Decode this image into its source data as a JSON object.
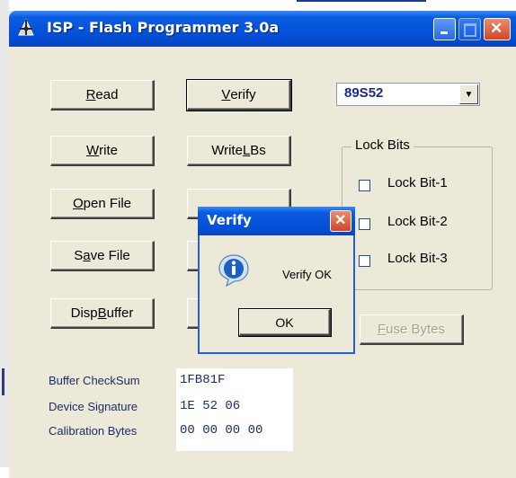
{
  "window": {
    "title": "ISP - Flash Programmer  3.0a",
    "icon": "isp-app-icon",
    "controls": [
      "minimize-icon",
      "maximize-icon",
      "close-icon"
    ]
  },
  "buttons": {
    "read": {
      "pre": "",
      "key": "R",
      "post": "ead"
    },
    "write": {
      "pre": "",
      "key": "W",
      "post": "rite"
    },
    "open_file": {
      "pre": "",
      "key": "O",
      "post": "pen File"
    },
    "save_file": {
      "pre": "S",
      "key": "a",
      "post": "ve File"
    },
    "disp_buffer": {
      "pre": "Disp ",
      "key": "B",
      "post": "uffer"
    },
    "verify": {
      "pre": "",
      "key": "V",
      "post": "erify"
    },
    "write_lbs": {
      "pre": "Write ",
      "key": "L",
      "post": "Bs"
    },
    "fuse_bytes": {
      "pre": "",
      "key": "F",
      "post": "use Bytes"
    }
  },
  "device_select": {
    "value": "89S52"
  },
  "lock_bits": {
    "label": "Lock Bits",
    "items": [
      {
        "label": "Lock Bit-1",
        "checked": false
      },
      {
        "label": "Lock Bit-2",
        "checked": false
      },
      {
        "label": "Lock Bit-3",
        "checked": false
      }
    ]
  },
  "info": {
    "buffer_checksum": {
      "label": "Buffer CheckSum",
      "value": "1FB81F"
    },
    "device_signature": {
      "label": "Device Signature",
      "value": "1E 52 06"
    },
    "calibration_bytes": {
      "label": "Calibration Bytes",
      "value": "00 00 00 00"
    }
  },
  "dialog": {
    "title": "Verify",
    "message": "Verify OK",
    "ok_label": "OK",
    "icon": "info-icon"
  },
  "colors": {
    "titlebar": "#0350d8",
    "face": "#ece9d8",
    "label_text": "#1c2c6a",
    "device_text": "#1b2a88"
  }
}
